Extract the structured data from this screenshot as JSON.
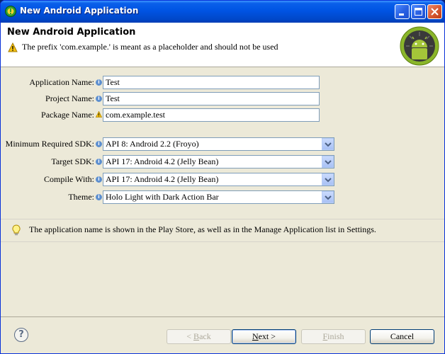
{
  "window": {
    "title": "New Android Application"
  },
  "header": {
    "title": "New Android Application",
    "message": "The prefix 'com.example.' is meant as a placeholder and should not be used"
  },
  "form": {
    "app_name": {
      "label": "Application Name:",
      "value": "Test"
    },
    "project_name": {
      "label": "Project Name:",
      "value": "Test"
    },
    "package_name": {
      "label": "Package Name:",
      "value": "com.example.test"
    },
    "min_sdk": {
      "label": "Minimum Required SDK:",
      "value": "API 8: Android 2.2 (Froyo)"
    },
    "target_sdk": {
      "label": "Target SDK:",
      "value": "API 17: Android 4.2 (Jelly Bean)"
    },
    "compile_with": {
      "label": "Compile With:",
      "value": "API 17: Android 4.2 (Jelly Bean)"
    },
    "theme": {
      "label": "Theme:",
      "value": "Holo Light with Dark Action Bar"
    }
  },
  "description": "The application name is shown in the Play Store, as well as in the Manage Application list in Settings.",
  "buttons": {
    "back": {
      "mnemonic": "B",
      "rest": "ack",
      "prefix": "< "
    },
    "next": {
      "mnemonic": "N",
      "rest": "ext >"
    },
    "finish": {
      "mnemonic": "F",
      "rest": "inish"
    },
    "cancel": "Cancel"
  },
  "icons": {
    "title": "eclipse-icon",
    "header_warning": "warning-icon",
    "logo": "android-logo",
    "info": "info-icon",
    "tip": "lightbulb-icon",
    "help": "help-icon"
  },
  "colors": {
    "titlebar": "#0054e3",
    "dialog_bg": "#ece9d8",
    "header_bg": "#ffffff",
    "android_green": "#a4c639"
  }
}
